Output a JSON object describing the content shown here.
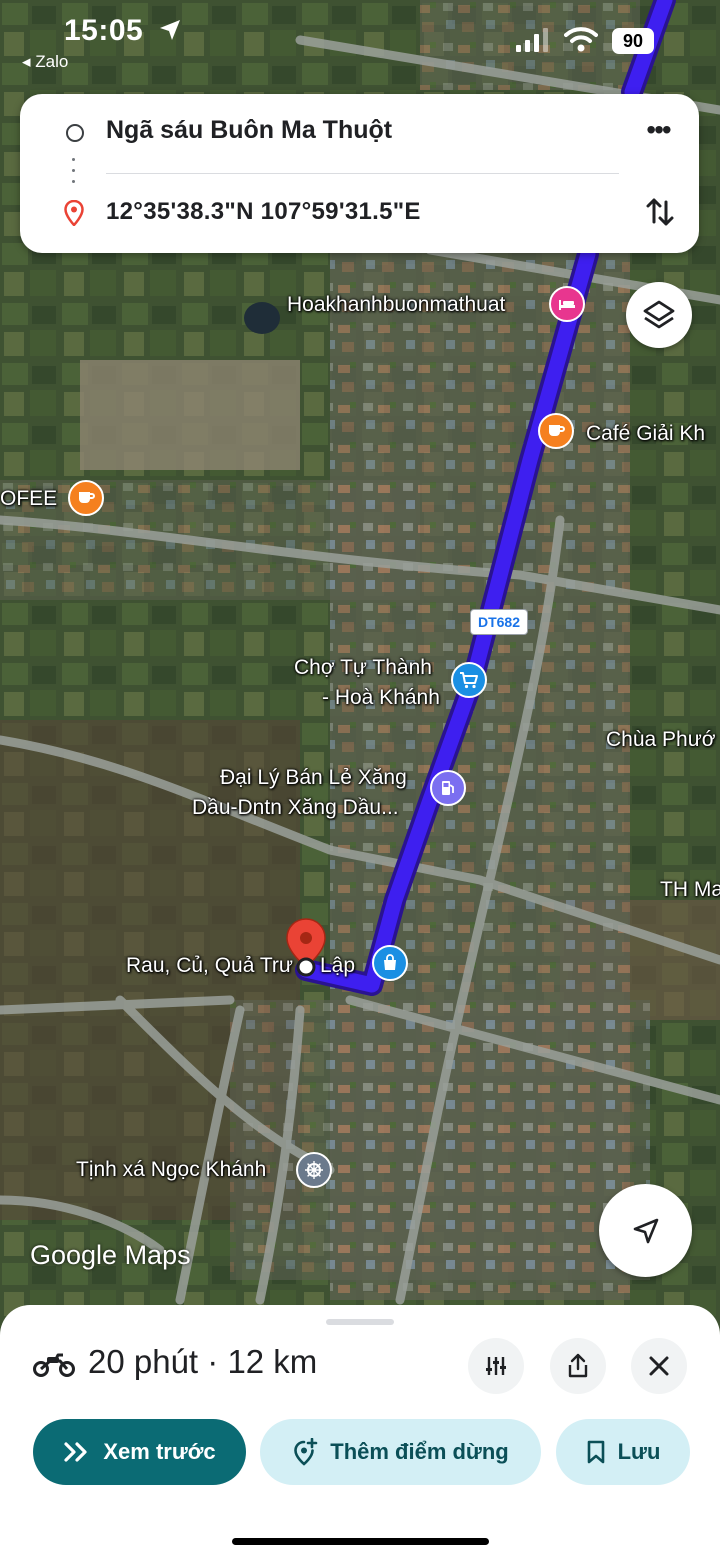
{
  "status_bar": {
    "time": "15:05",
    "back_app": "Zalo",
    "battery": "90"
  },
  "directions": {
    "origin": "Ngã sáu Buôn Ma Thuột",
    "destination": "12°35'38.3\"N 107°59'31.5\"E"
  },
  "map": {
    "road_shield": "DT682",
    "watermark": "Google Maps",
    "labels": {
      "hotel": "Hoakhanhbuonmathuat",
      "cafe": "Café Giải Kh",
      "cafe_left": "OFEE",
      "market_line1": "Chợ Tự Thành",
      "market_line2": "- Hoà Khánh",
      "pagoda": "Chùa Phướ",
      "gas_line1": "Đại Lý Bán Lẻ Xăng",
      "gas_line2": "Dầu-Dntn Xăng Dầu...",
      "school": "TH Ma",
      "grocery_left": "Rau, Củ, Quả Trư",
      "grocery_right": "Lập",
      "temple": "Tịnh xá Ngọc Khánh"
    },
    "colors": {
      "route": "#3e1ff0",
      "hotel": "#e8368f",
      "cafe": "#f5801f",
      "shop": "#1a8fe3",
      "gas": "#7b6ff0",
      "pin": "#ea4335"
    }
  },
  "route_sheet": {
    "duration": "20 phút",
    "separator": " · ",
    "distance": "12 km",
    "preview_label": "Xem trước",
    "add_stop_label": "Thêm điểm dừng",
    "save_label": "Lưu"
  },
  "icons": [
    "location-arrow-icon",
    "signal-icon",
    "wifi-icon",
    "origin-circle-icon",
    "destination-pin-icon",
    "more-icon",
    "swap-icon",
    "layers-icon",
    "motorbike-icon",
    "options-icon",
    "share-icon",
    "close-icon",
    "my-location-icon"
  ]
}
